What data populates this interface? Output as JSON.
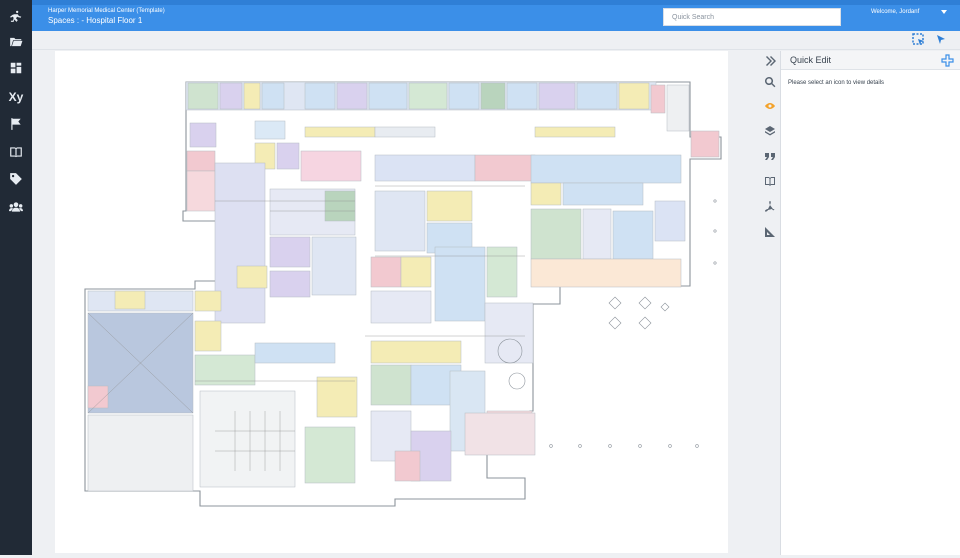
{
  "header": {
    "site_name": "Harper Memorial Medical Center (Template)",
    "page_title": "Spaces : - Hospital Floor 1",
    "search_placeholder": "Quick Search",
    "welcome_text": "Welcome, Jordanf"
  },
  "sidebar": {
    "items": [
      {
        "icon": "app-logo-icon"
      },
      {
        "icon": "folder-icon"
      },
      {
        "icon": "dashboard-icon"
      },
      {
        "icon": "xy-icon",
        "label": "Xy"
      },
      {
        "icon": "flag-icon"
      },
      {
        "icon": "book-icon"
      },
      {
        "icon": "tag-icon"
      },
      {
        "icon": "users-icon"
      }
    ]
  },
  "toolbar": {
    "tools": [
      {
        "icon": "select-area-icon"
      },
      {
        "icon": "pointer-icon"
      }
    ]
  },
  "map_tools": {
    "items": [
      {
        "icon": "collapse-icon"
      },
      {
        "icon": "search-icon"
      },
      {
        "icon": "eye-icon"
      },
      {
        "icon": "layers-icon"
      },
      {
        "icon": "quote-icon"
      },
      {
        "icon": "book-icon"
      },
      {
        "icon": "acrobat-icon"
      },
      {
        "icon": "measure-icon"
      }
    ]
  },
  "quick_edit": {
    "title": "Quick Edit",
    "message": "Please select an icon to view details"
  },
  "colors": {
    "accent": "#3b8fe8",
    "sidebar": "#212a36",
    "active_eye": "#f3a22a"
  }
}
